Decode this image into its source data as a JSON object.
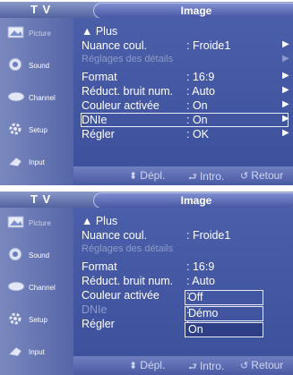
{
  "panels": [
    {
      "top_label": "T V",
      "title": "Image",
      "sidebar": [
        "Picture",
        "Sound",
        "Channel",
        "Setup",
        "Input"
      ],
      "more_label": "▲ Plus",
      "rows": [
        {
          "name": "Nuance coul.",
          "value": ": Froide1"
        },
        {
          "name": "Réglages des détails",
          "value": ""
        },
        {
          "name": "Format",
          "value": ": 16:9"
        },
        {
          "name": "Réduct. bruit num.",
          "value": ": Auto"
        },
        {
          "name": "Couleur activée",
          "value": ": On"
        },
        {
          "name": "DNIe",
          "value": ": On"
        },
        {
          "name": "Régler",
          "value": ": OK"
        }
      ],
      "bottom": {
        "move": "Dépl.",
        "enter": "Intro.",
        "return": "Retour"
      }
    },
    {
      "top_label": "T V",
      "title": "Image",
      "sidebar": [
        "Picture",
        "Sound",
        "Channel",
        "Setup",
        "Input"
      ],
      "more_label": "▲ Plus",
      "rows": [
        {
          "name": "Nuance coul.",
          "value": ": Froide1"
        },
        {
          "name": "Réglages des détails",
          "value": ""
        },
        {
          "name": "Format",
          "value": ": 16:9"
        },
        {
          "name": "Réduct. bruit num.",
          "value": ": Auto"
        },
        {
          "name": "Couleur activée",
          "value": ":"
        },
        {
          "name": "DNIe",
          "value": ":"
        },
        {
          "name": "Régler",
          "value": ":"
        }
      ],
      "dropdown": [
        "Off",
        "Démo",
        "On"
      ],
      "bottom": {
        "move": "Dépl.",
        "enter": "Intro.",
        "return": "Retour"
      }
    }
  ],
  "colors": {
    "accent": "#4a5ea9",
    "sidebar": "#6677b5",
    "text": "#ffffff",
    "dim": "#8f9acb"
  }
}
